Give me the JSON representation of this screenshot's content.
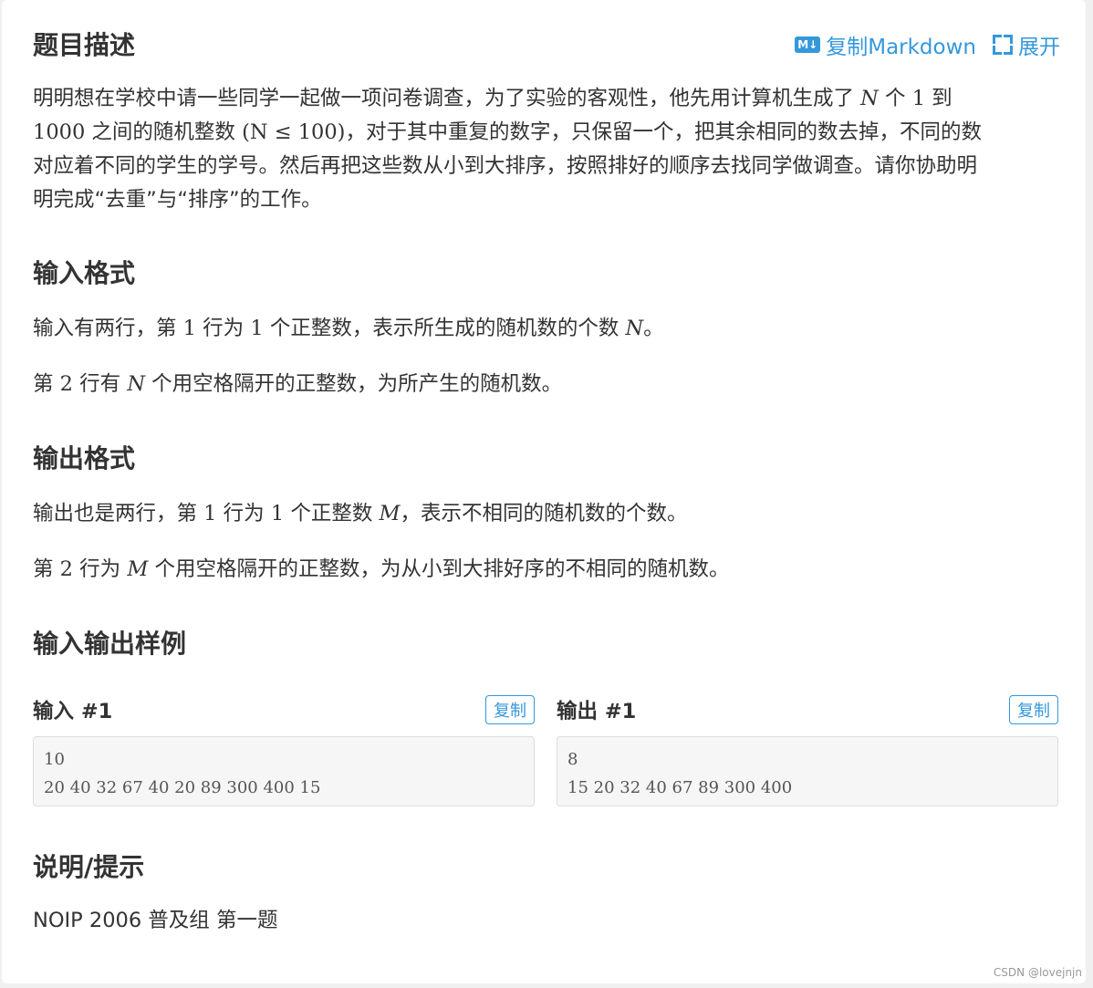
{
  "header": {
    "title": "题目描述",
    "copy_markdown": "复制Markdown",
    "expand": "展开",
    "md_icon_text": "M↓"
  },
  "description": {
    "l1a": "明明想在学校中请一些同学一起做一项问卷调查，为了实验的客观性，他先用计算机生成了",
    "N": "N",
    "l1b": "个",
    "one": "1",
    "l1c": "到",
    "thousand": "1000",
    "l2a": "之间的随机整数",
    "cond": "(N ≤ 100)",
    "l2b": "，对于其中重复的数字，只保留一个，把其余相同的数去掉，不同的数",
    "l3": "对应着不同的学生的学号。然后再把这些数从小到大排序，按照排好的顺序去找同学做调查。请你协助明",
    "l4": "明完成“去重”与“排序”的工作。"
  },
  "input_format": {
    "title": "输入格式",
    "p1a": "输入有两行，第",
    "p1n1": "1",
    "p1b": "行为",
    "p1n2": "1",
    "p1c": "个正整数，表示所生成的随机数的个数",
    "p1var": "N",
    "p1d": "。",
    "p2a": "第",
    "p2n": "2",
    "p2b": "行有",
    "p2var": "N",
    "p2c": "个用空格隔开的正整数，为所产生的随机数。"
  },
  "output_format": {
    "title": "输出格式",
    "p1a": "输出也是两行，第",
    "p1n1": "1",
    "p1b": "行为",
    "p1n2": "1",
    "p1c": "个正整数",
    "p1var": "M",
    "p1d": "，表示不相同的随机数的个数。",
    "p2a": "第",
    "p2n": "2",
    "p2b": "行为",
    "p2var": "M",
    "p2c": "个用空格隔开的正整数，为从小到大排好序的不相同的随机数。"
  },
  "samples": {
    "title": "输入输出样例",
    "input_title": "输入 #1",
    "output_title": "输出 #1",
    "copy_label": "复制",
    "input_text": "10\n20 40 32 67 40 20 89 300 400 15",
    "output_text": "8\n15 20 32 40 67 89 300 400"
  },
  "hint": {
    "title": "说明/提示",
    "text": "NOIP 2006 普及组 第一题"
  },
  "watermark": "CSDN @lovejnjn"
}
